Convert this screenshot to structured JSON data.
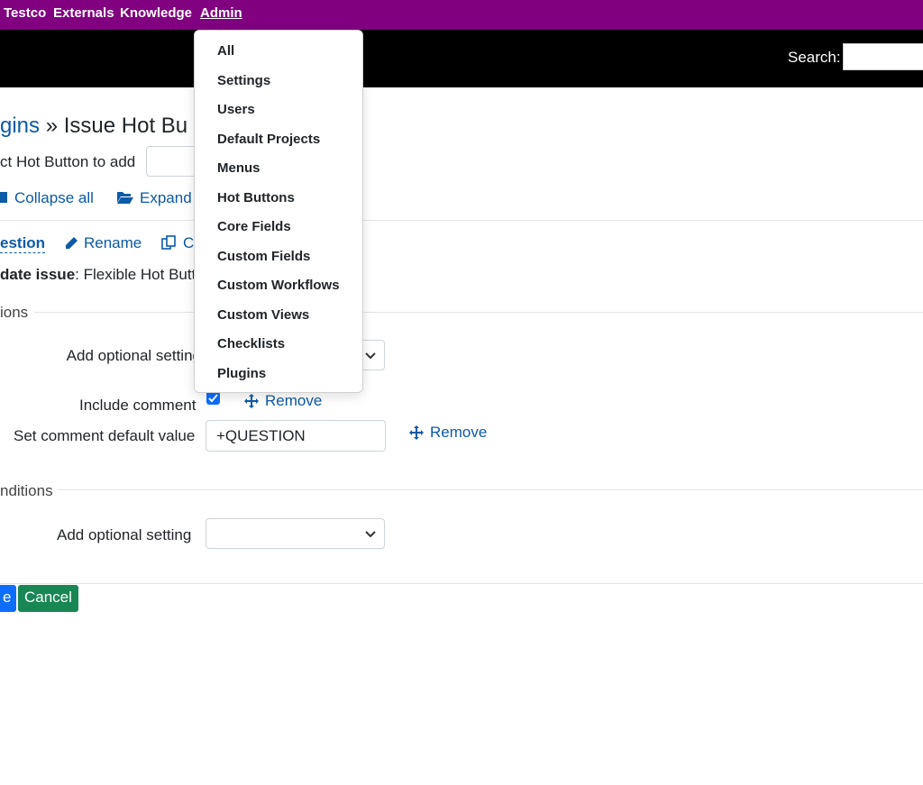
{
  "topnav": {
    "items": [
      "Testco",
      "Externals",
      "Knowledge",
      "Admin"
    ]
  },
  "search": {
    "label": "Search:"
  },
  "page": {
    "breadcrumb_link": "gins",
    "breadcrumb_sep": "»",
    "title_rest": "Issue Hot Bu",
    "select_hot_button_label": "ct Hot Button to add",
    "collapse_all": "Collapse all",
    "expand_all": "Expand",
    "tab_question": "estion",
    "rename": "Rename",
    "copy_partial": "C",
    "update_issue_label": "date issue",
    "update_issue_value": ": Flexible Hot Butto",
    "section_actions": "ions",
    "add_optional_setting_1": "Add optional setting",
    "include_comment": "Include comment",
    "set_comment_default": "Set comment default value",
    "comment_default_value": "+QUESTION",
    "remove": "Remove",
    "section_conditions": "nditions",
    "add_optional_setting_2": "Add optional setting",
    "save_partial": "e",
    "cancel": "Cancel"
  },
  "admin_menu": {
    "items": [
      "All",
      "Settings",
      "Users",
      "Default Projects",
      "Menus",
      "Hot Buttons",
      "Core Fields",
      "Custom Fields",
      "Custom Workflows",
      "Custom Views",
      "Checklists",
      "Plugins"
    ]
  },
  "colors": {
    "topnav_bg": "#800080",
    "link_blue": "#0d5aa7",
    "save_button": "#0d6efd",
    "cancel_button": "#198754"
  }
}
